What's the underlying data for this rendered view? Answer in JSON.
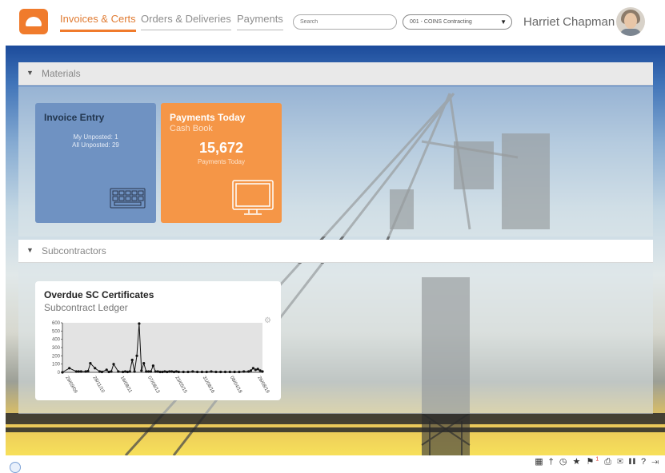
{
  "nav": {
    "tabs": [
      {
        "label": "Invoices & Certs",
        "active": true
      },
      {
        "label": "Orders & Deliveries",
        "active": false
      },
      {
        "label": "Payments",
        "active": false
      }
    ]
  },
  "header": {
    "search_placeholder": "Search",
    "company_selected": "001 - COINS Contracting",
    "user_name": "Harriet Chapman"
  },
  "colors": {
    "accent": "#f07b2c",
    "tile_blue": "#6f92c2",
    "tile_orange": "#f59647"
  },
  "sections": {
    "materials": {
      "title": "Materials",
      "tiles": {
        "invoice_entry": {
          "title": "Invoice Entry",
          "line1": "My Unposted: 1",
          "line2": "All Unposted: 29",
          "icon": "keyboard-icon"
        },
        "payments_today": {
          "title": "Payments Today",
          "subtitle": "Cash Book",
          "value": "15,672",
          "caption": "Payments Today",
          "icon": "monitor-icon"
        }
      }
    },
    "subcontractors": {
      "title": "Subcontractors",
      "tile": {
        "title": "Overdue SC Certificates",
        "subtitle": "Subcontract Ledger",
        "settings_icon": "gear-icon"
      }
    }
  },
  "chart_data": {
    "type": "line",
    "title": "Overdue SC Certificates",
    "ylim": [
      0,
      600
    ],
    "yticks": [
      0,
      100,
      200,
      300,
      400,
      500,
      600
    ],
    "xticks": [
      "29/09/09",
      "28/11/10",
      "16/08/11",
      "07/08/13",
      "23/05/15",
      "31/08/16",
      "08/04/18",
      "26/08/19"
    ],
    "x": [
      0,
      3,
      6,
      7,
      8,
      10,
      11,
      12,
      14,
      16,
      17,
      19,
      20,
      21,
      22,
      24,
      26,
      27,
      28,
      29,
      30,
      31,
      32,
      33,
      34,
      35,
      36,
      37,
      38,
      39,
      40,
      41,
      42,
      43,
      44,
      45,
      46,
      47,
      48,
      49,
      50,
      52,
      54,
      56,
      58,
      60,
      62,
      64,
      66,
      68,
      70,
      72,
      74,
      76,
      78,
      80,
      81,
      82,
      83,
      84,
      85,
      86
    ],
    "values": [
      0,
      50,
      10,
      10,
      10,
      10,
      15,
      110,
      50,
      10,
      5,
      30,
      5,
      10,
      100,
      10,
      5,
      10,
      5,
      10,
      150,
      10,
      200,
      590,
      20,
      110,
      10,
      10,
      10,
      80,
      10,
      10,
      5,
      5,
      10,
      5,
      10,
      10,
      5,
      10,
      5,
      5,
      5,
      10,
      5,
      5,
      5,
      10,
      5,
      5,
      5,
      5,
      5,
      5,
      10,
      10,
      20,
      50,
      30,
      40,
      20,
      10
    ],
    "grid": false
  },
  "status_bar": {
    "icons": [
      "grid-icon",
      "pin-icon",
      "history-icon",
      "star-icon",
      "flag-icon",
      "print-icon",
      "mail-icon",
      "library-icon",
      "help-icon",
      "logout-icon"
    ],
    "notification_badge": "1"
  }
}
